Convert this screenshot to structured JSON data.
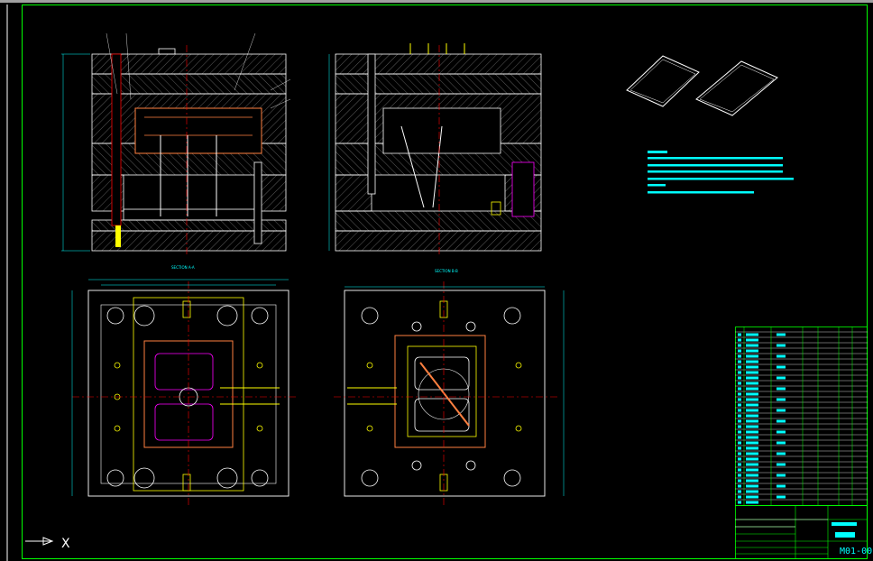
{
  "viewport": {
    "background": "#000000",
    "frame_color": "#00ff00",
    "geometry_color": "#ffffff",
    "annotation_color": "#00ffff",
    "hidden_line_color": "#ff8040",
    "centerline_color": "#ff0000",
    "highlight_color": "#ffff00"
  },
  "views": {
    "section_a": {
      "label": "SECTION A-A"
    },
    "section_b": {
      "label": "SECTION B-B"
    }
  },
  "title_block": {
    "drawing_number": "M01-00"
  },
  "ucs_icon": {
    "x_label": "X",
    "icon": "ucs-arrow-icon"
  }
}
